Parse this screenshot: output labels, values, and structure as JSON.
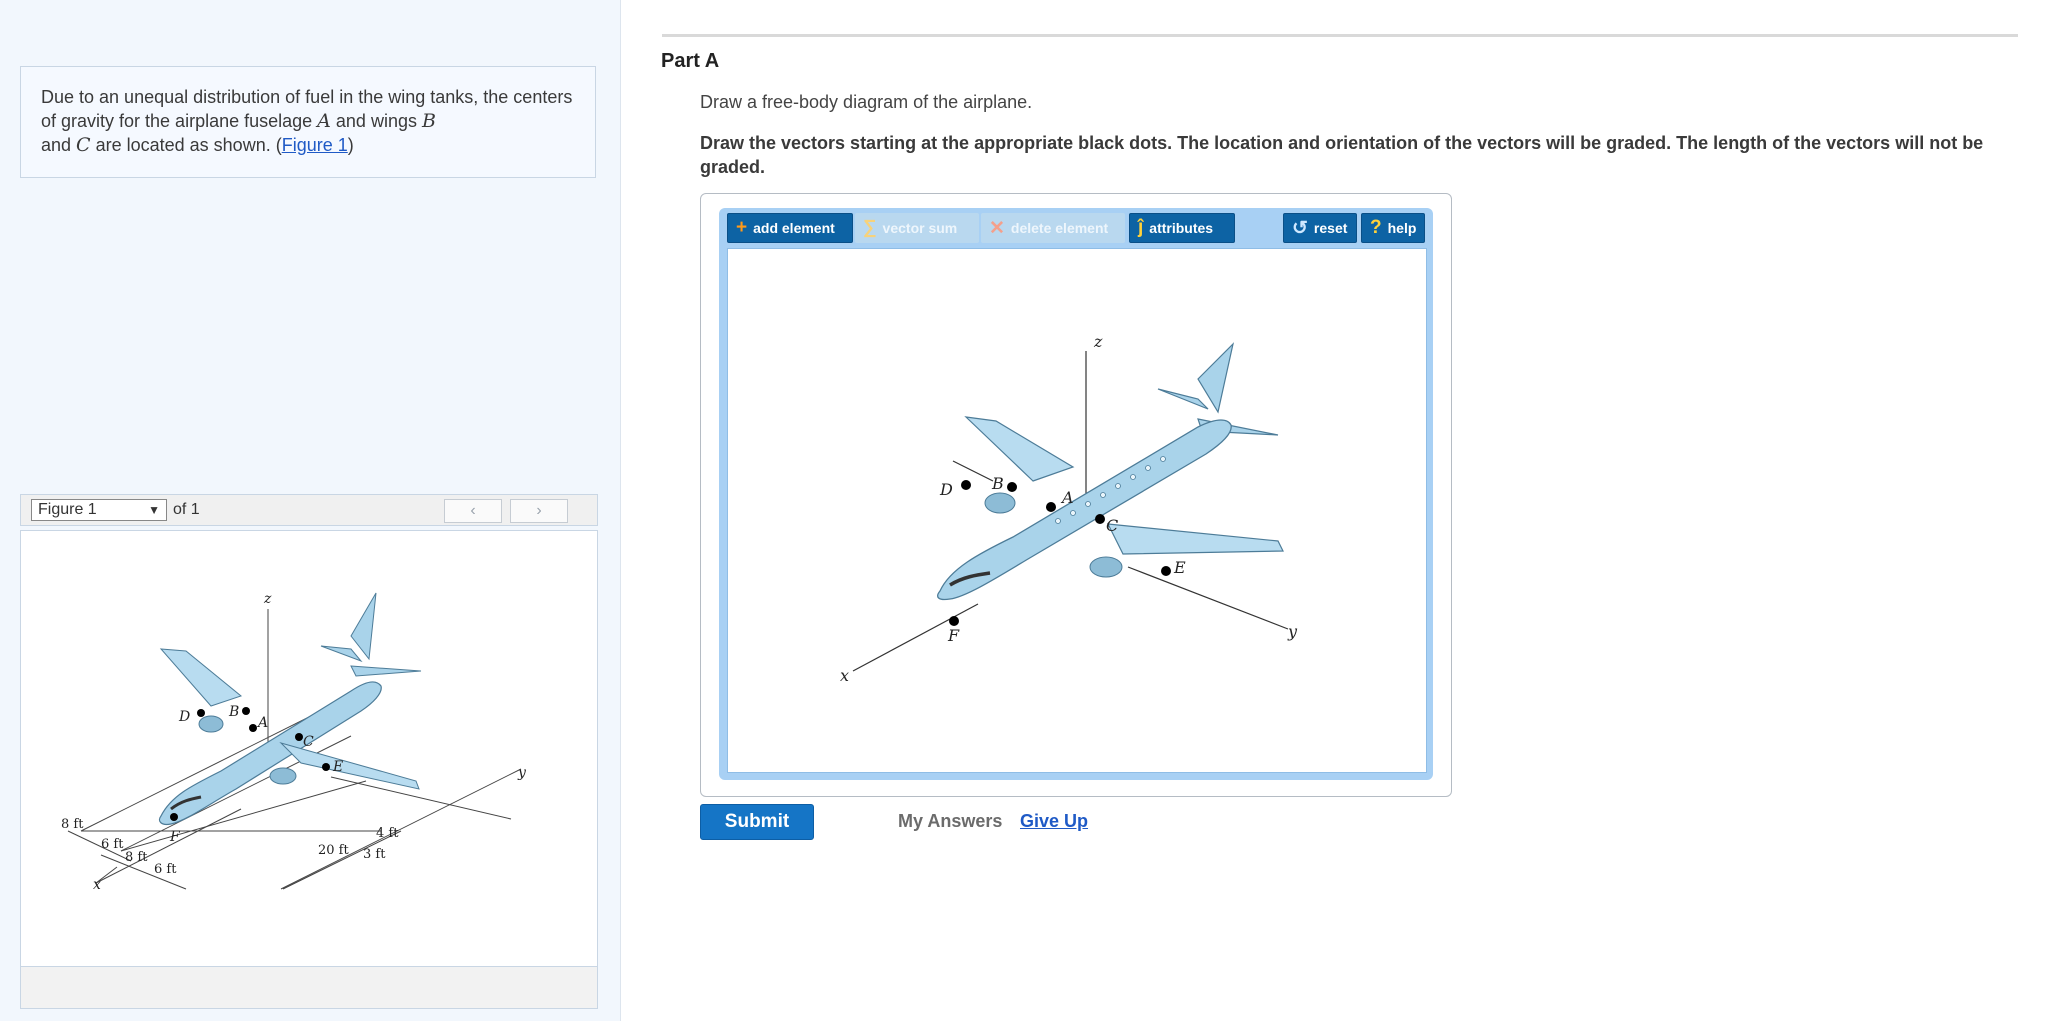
{
  "problem": {
    "text_1": "Due to an unequal distribution of fuel in the wing tanks, the centers of gravity for the airplane fuselage ",
    "var_a": "A",
    "text_2": " and wings ",
    "var_b": "B",
    "text_3": " and ",
    "var_c": "C",
    "text_4": " are located as shown. (",
    "figure_link": "Figure 1",
    "text_5": ")"
  },
  "figure_nav": {
    "selected": "Figure 1",
    "of_label": "of 1",
    "prev_glyph": "‹",
    "next_glyph": "›"
  },
  "figure": {
    "points": [
      "A",
      "B",
      "C",
      "D",
      "E",
      "F"
    ],
    "axes": [
      "x",
      "y",
      "z"
    ],
    "dimensions": [
      "8 ft",
      "6 ft",
      "8 ft",
      "6 ft",
      "20 ft",
      "4 ft",
      "3 ft"
    ]
  },
  "part": {
    "title": "Part A",
    "instruction": "Draw a free-body diagram of the airplane.",
    "bold_instruction": "Draw the vectors starting at the appropriate black dots. The location and orientation of the vectors will be graded. The length of the vectors will not be graded."
  },
  "toolbar": {
    "add_element": "add element",
    "vector_sum": "vector sum",
    "delete_element": "delete element",
    "attributes": "attributes",
    "reset": "reset",
    "help": "help",
    "add_icon": "+",
    "sum_icon": "∑",
    "delete_icon": "✕",
    "attr_icon": "ĵ",
    "reset_icon": "↺",
    "help_icon": "?"
  },
  "actions": {
    "submit": "Submit",
    "my_answers": "My Answers",
    "give_up": "Give Up"
  },
  "colors": {
    "accent": "#1575c6",
    "toolbar_active": "#0d63a4",
    "toolbar_disabled": "#b9d8ef",
    "panel": "#a8d0f4",
    "plane_body": "#a9d3ea"
  }
}
